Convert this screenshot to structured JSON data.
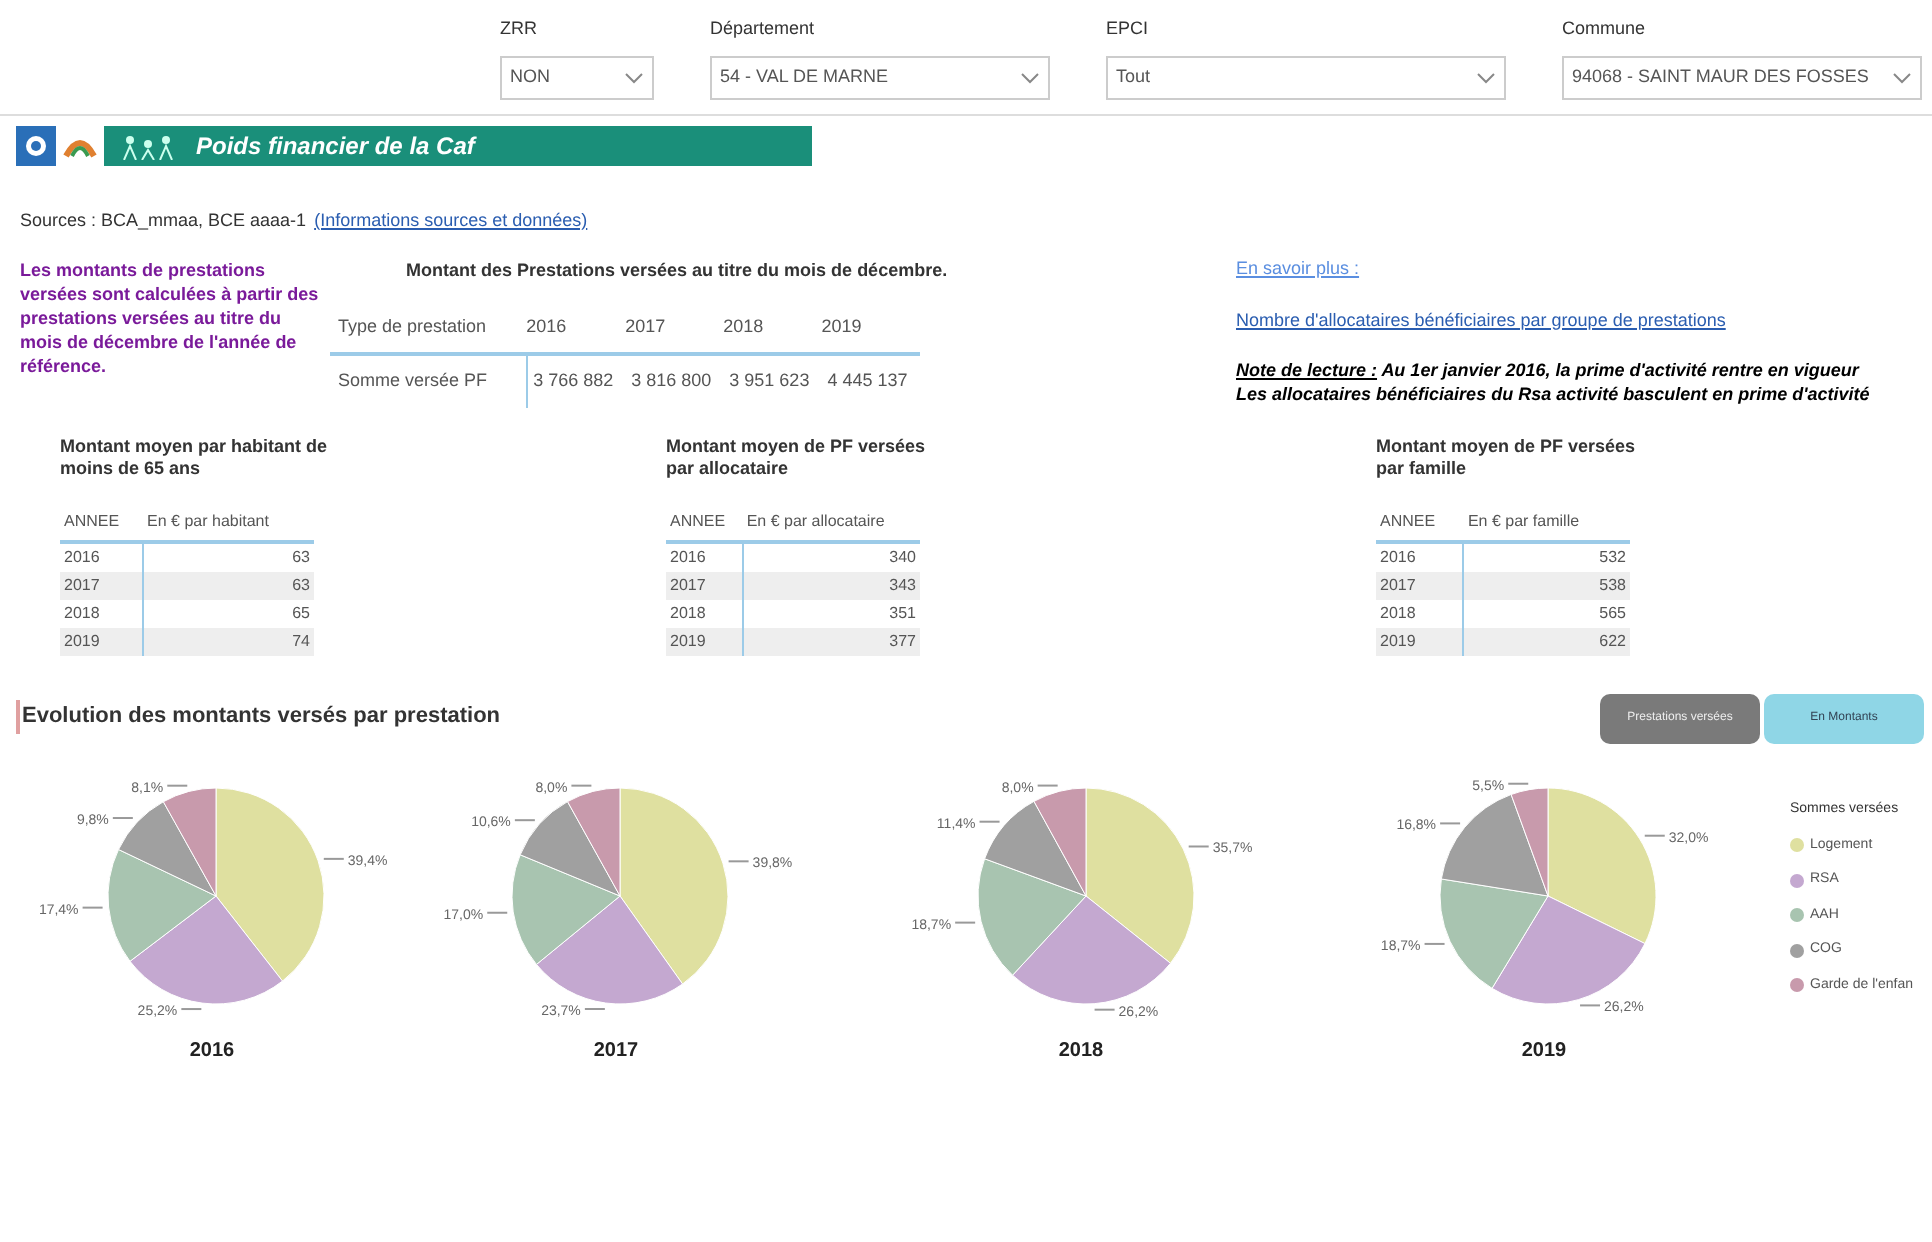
{
  "filters": [
    {
      "label": "ZRR",
      "value": "NON"
    },
    {
      "label": "Département",
      "value": "54 - VAL DE MARNE"
    },
    {
      "label": "EPCI",
      "value": "Tout"
    },
    {
      "label": "Commune",
      "value": "94068 - SAINT MAUR DES FOSSES"
    }
  ],
  "banner": {
    "title": "Poids financier de la Caf"
  },
  "sources": {
    "text": "Sources : BCA_mmaa, BCE aaaa-1",
    "link": "(Informations sources et données)"
  },
  "intro_note": "Les montants de prestations versées sont calculées à partir des prestations versées au titre du mois de décembre de l'année de référence.",
  "main_table": {
    "title": "Montant des Prestations versées au titre du mois de décembre.",
    "columns": [
      "Type de prestation",
      "2016",
      "2017",
      "2018",
      "2019"
    ],
    "rows": [
      [
        "Somme versée PF",
        "3 766 882",
        "3 816 800",
        "3 951 623",
        "4 445 137"
      ]
    ]
  },
  "links": [
    "En savoir plus :",
    "Nombre d'allocataires bénéficiaires par groupe de prestations"
  ],
  "reading_note": {
    "label": "Note de lecture :",
    "lines": [
      "Au 1er janvier 2016, la prime d'activité rentre en vigueur",
      "Les allocataires bénéficiaires du Rsa activité basculent en prime d'activité"
    ]
  },
  "small_tables": [
    {
      "title": "Montant moyen par habitant de moins de  65 ans",
      "columns": [
        "ANNEE",
        "En € par habitant"
      ],
      "rows": [
        [
          "2016",
          "63"
        ],
        [
          "2017",
          "63"
        ],
        [
          "2018",
          "65"
        ],
        [
          "2019",
          "74"
        ]
      ]
    },
    {
      "title": "Montant moyen de PF versées par allocataire",
      "columns": [
        "ANNEE",
        "En € par allocataire"
      ],
      "rows": [
        [
          "2016",
          "340"
        ],
        [
          "2017",
          "343"
        ],
        [
          "2018",
          "351"
        ],
        [
          "2019",
          "377"
        ]
      ]
    },
    {
      "title": "Montant moyen de PF versées par famille",
      "columns": [
        "ANNEE",
        "En € par famille"
      ],
      "rows": [
        [
          "2016",
          "532"
        ],
        [
          "2017",
          "538"
        ],
        [
          "2018",
          "565"
        ],
        [
          "2019",
          "622"
        ]
      ]
    }
  ],
  "section_title": "Evolution des montants versés par prestation",
  "toggle_buttons": [
    {
      "label": "Prestations versées",
      "selected": false
    },
    {
      "label": "En Montants",
      "selected": true
    }
  ],
  "pies": [
    {
      "chart_data": {
        "type": "pie",
        "title": "2016",
        "values": [
          39.4,
          25.2,
          17.4,
          9.8,
          8.1
        ],
        "value_labels": [
          "39,4%",
          "25,2%",
          "17,4%",
          "9,8%",
          "8,1%"
        ]
      }
    },
    {
      "chart_data": {
        "type": "pie",
        "title": "2017",
        "values": [
          39.8,
          23.7,
          17.0,
          10.6,
          8.0
        ],
        "value_labels": [
          "39,8%",
          "23,7%",
          "17,0%",
          "10,6%",
          "8,0%"
        ]
      }
    },
    {
      "chart_data": {
        "type": "pie",
        "title": "2018",
        "values": [
          35.7,
          26.2,
          18.7,
          11.4,
          8.0
        ],
        "value_labels": [
          "35,7%",
          "26,2%",
          "18,7%",
          "11,4%",
          "8,0%"
        ]
      }
    },
    {
      "chart_data": {
        "type": "pie",
        "title": "2019",
        "values": [
          32.0,
          26.2,
          18.7,
          16.8,
          5.5
        ],
        "value_labels": [
          "32,0%",
          "26,2%",
          "18,7%",
          "16,8%",
          "5,5%"
        ]
      }
    }
  ],
  "legend": {
    "title": "Sommes versées",
    "items": [
      {
        "label": "Logement",
        "color": "#dfe0a0"
      },
      {
        "label": "RSA",
        "color": "#c4a8d0"
      },
      {
        "label": "AAH",
        "color": "#a8c4b0"
      },
      {
        "label": "COG",
        "color": "#a0a0a0"
      },
      {
        "label": "Garde de l'enfan",
        "color": "#c89aac"
      }
    ]
  }
}
